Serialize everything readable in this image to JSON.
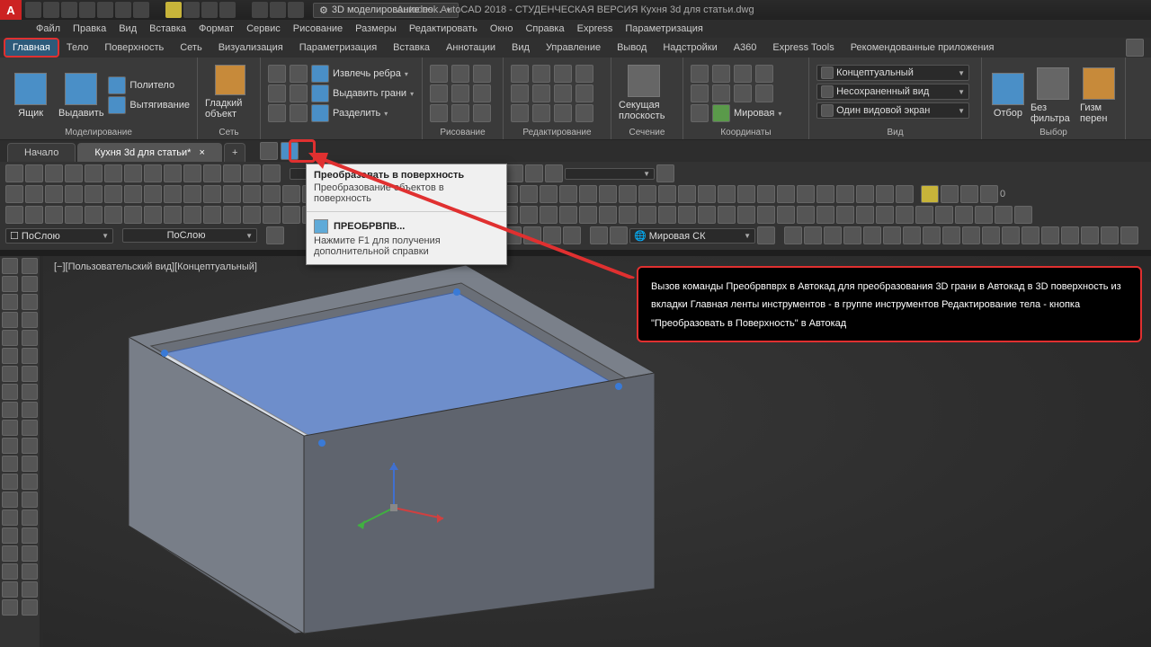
{
  "title": "Autodesk AutoCAD 2018 - СТУДЕНЧЕСКАЯ ВЕРСИЯ   Кухня 3d для статьи.dwg",
  "workspace_dropdown": "3D моделирование по...",
  "menubar": [
    "Файл",
    "Правка",
    "Вид",
    "Вставка",
    "Формат",
    "Сервис",
    "Рисование",
    "Размеры",
    "Редактировать",
    "Окно",
    "Справка",
    "Express",
    "Параметризация"
  ],
  "ribtabs": [
    "Главная",
    "Тело",
    "Поверхность",
    "Сеть",
    "Визуализация",
    "Параметризация",
    "Вставка",
    "Аннотации",
    "Вид",
    "Управление",
    "Вывод",
    "Надстройки",
    "A360",
    "Express Tools",
    "Рекомендованные приложения"
  ],
  "ribtab_active": 0,
  "panels": {
    "p1": {
      "label": "Моделирование",
      "btn1": "Ящик",
      "btn2": "Выдавить",
      "opt1": "Политело",
      "opt2": "Вытягивание",
      "opt3": "Гладкий объект"
    },
    "p2": {
      "label": "Сеть"
    },
    "p3": {
      "label": "",
      "r1": "Извлечь ребра",
      "r2": "Выдавить грани",
      "r3": "Разделить"
    },
    "p4": {
      "label": "Рисование"
    },
    "p5": {
      "label": "Редактирование"
    },
    "p6": {
      "label": "Сечение",
      "btn": "Секущая плоскость"
    },
    "p7": {
      "label": "Координаты",
      "cs": "Мировая"
    },
    "p8": {
      "label": "Вид",
      "visual": "Концептуальный",
      "saved": "Несохраненный вид",
      "screens": "Один видовой экран"
    },
    "p9": {
      "label": "Выбор",
      "btn1": "Отбор",
      "btn2": "Без фильтра",
      "btn3": "Гизм перен"
    }
  },
  "filetabs": {
    "t1": "Начало",
    "t2": "Кухня 3d для статьи*"
  },
  "layerdrop": "☐ ПоСлою",
  "linedrop": "ПоСлою",
  "csdrop": "Мировая СК",
  "viewport_label": "[−][Пользовательский вид][Концептуальный]",
  "tooltip": {
    "title": "Преобразовать в поверхность",
    "desc": "Преобразование объектов в поверхность",
    "cmd": "ПРЕОБРВПВ...",
    "help": "Нажмите F1 для получения дополнительной справки"
  },
  "callout_text": "Вызов команды Преобрвпврх в Автокад для преобразования 3D грани в Автокад в 3D поверхность из вкладки Главная ленты инструментов - в группе инструментов Редактирование тела - кнопка \"Преобразовать в Поверхность\" в Автокад"
}
